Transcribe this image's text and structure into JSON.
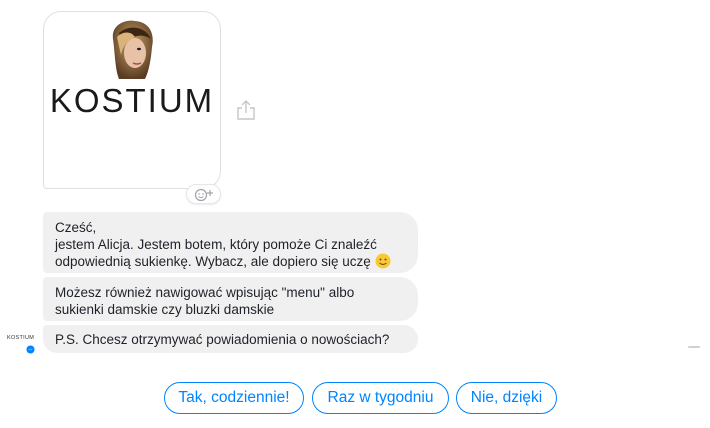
{
  "card": {
    "logo_text": "KOSTIUM",
    "image_icon": "profile-photo"
  },
  "messages": [
    {
      "lines": [
        "Cześć,",
        "jestem Alicja. Jestem botem, który pomoże Ci znaleźć",
        "odpowiednią sukienkę. Wybacz, ale dopiero się uczę"
      ],
      "emoji": "slightly-smiling-face"
    },
    {
      "lines": [
        "Możesz również nawigować wpisując \"menu\" albo",
        "sukienki damskie czy bluzki damskie"
      ]
    },
    {
      "lines": [
        "P.S. Chcesz otrzymywać powiadomienia o nowościach?"
      ]
    }
  ],
  "sender": {
    "logo_text": "KOSTIUM",
    "badge_icon": "messenger-icon"
  },
  "quick_replies": [
    "Tak, codziennie!",
    "Raz w tygodniu",
    "Nie, dzięki"
  ],
  "colors": {
    "accent": "#0084ff",
    "bubble_bg": "#f1f0f0",
    "text": "#1d2129"
  }
}
